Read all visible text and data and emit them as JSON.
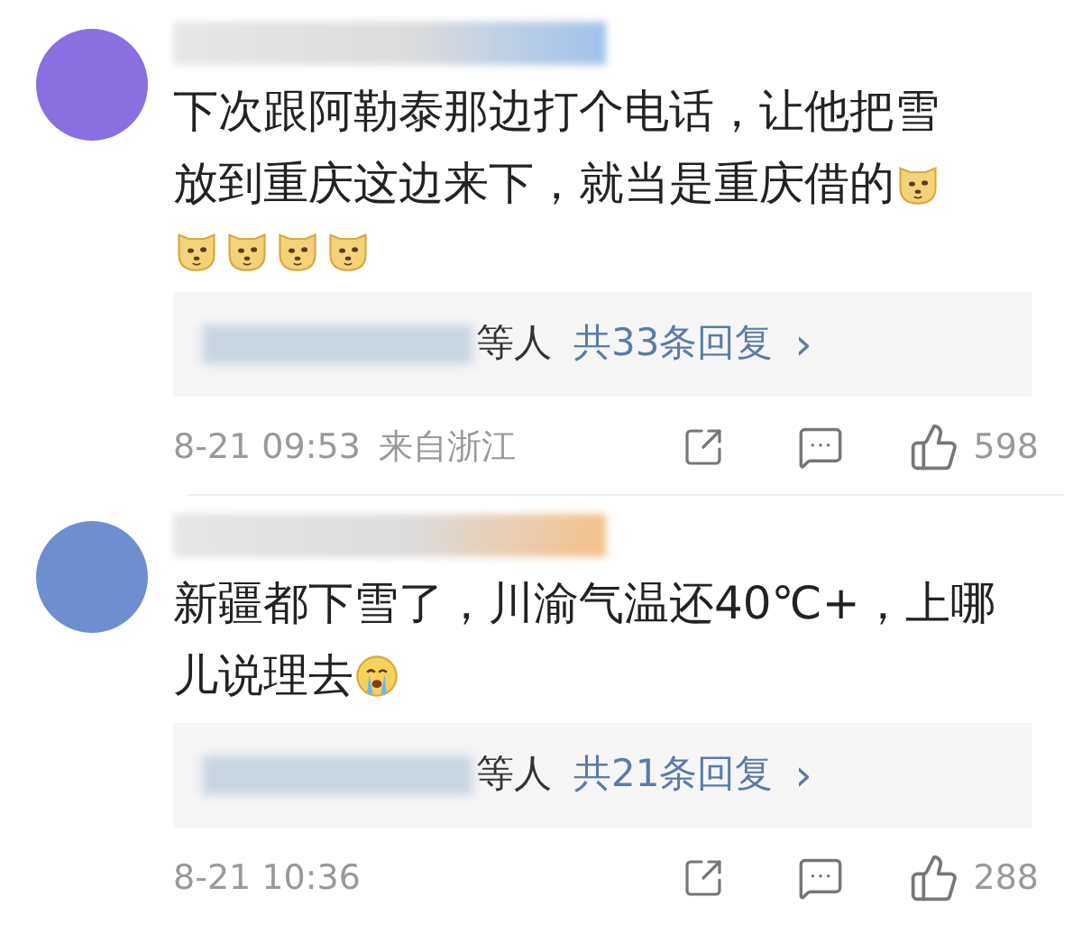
{
  "comments": [
    {
      "avatar": {
        "color": "#8a6fe0"
      },
      "name": {
        "color": "#9fc2ea"
      },
      "lines": [
        {
          "text": "下次跟阿勒泰那边打个电话，让他把雪"
        },
        {
          "text": "放到重庆这边来下，就当是重庆借的",
          "emojis": [
            {
              "kind": "dog"
            }
          ]
        },
        {
          "emojis": [
            {
              "kind": "dog"
            },
            {
              "kind": "dog"
            },
            {
              "kind": "dog"
            },
            {
              "kind": "dog"
            }
          ]
        }
      ],
      "replies": {
        "suffix": "等人",
        "link": "共33条回复",
        "arrow": "›"
      },
      "time": "8-21 09:53",
      "location": "来自浙江",
      "likes": "598"
    },
    {
      "avatar": {
        "color": "#6d8fd0"
      },
      "name": {
        "color": "#f4c08a"
      },
      "lines": [
        {
          "text": "新疆都下雪了，川渝气温还40℃+，上哪"
        },
        {
          "text": "儿说理去",
          "emojis": [
            {
              "kind": "crying"
            }
          ]
        }
      ],
      "replies": {
        "suffix": "等人",
        "link": "共21条回复",
        "arrow": "›"
      },
      "time": "8-21 10:36",
      "likes": "288"
    }
  ]
}
